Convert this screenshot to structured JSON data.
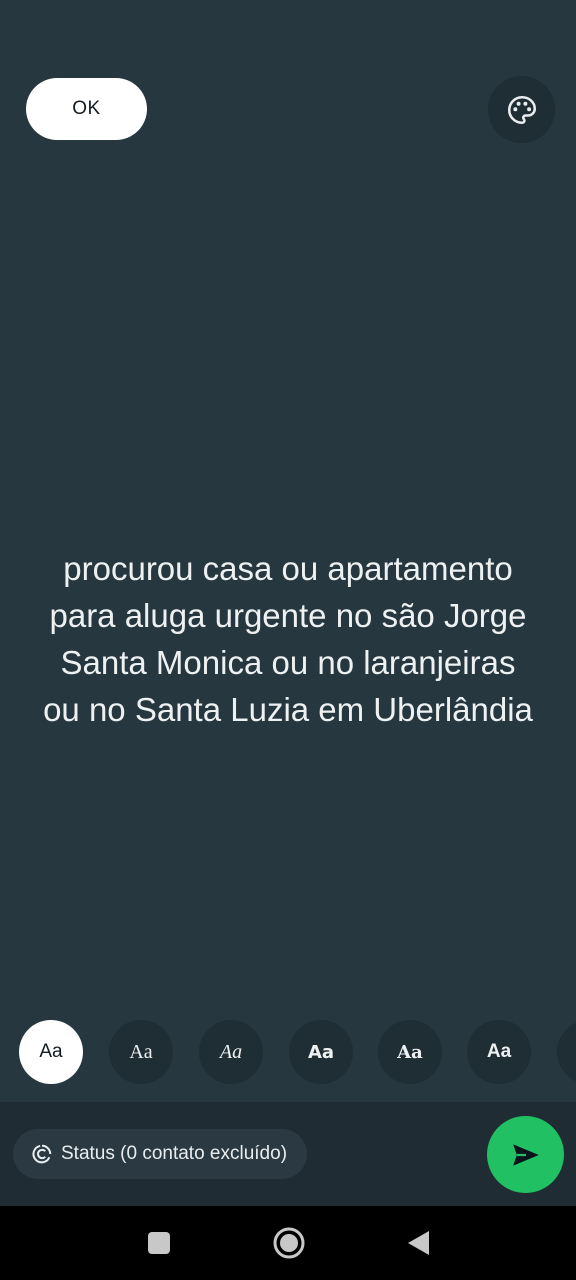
{
  "header": {
    "ok_label": "OK",
    "palette_icon": "palette-icon"
  },
  "status": {
    "lines": [
      "procurou casa ou apartamento",
      "para aluga urgente no são Jorge",
      "Santa Monica ou no laranjeiras",
      "ou no Santa Luzia em Uberlândia"
    ]
  },
  "font_picker": {
    "options": [
      {
        "label": "Aa",
        "selected": true
      },
      {
        "label": "Aa",
        "selected": false
      },
      {
        "label": "Aa",
        "selected": false
      },
      {
        "label": "Aa",
        "selected": false
      },
      {
        "label": "Aa",
        "selected": false
      },
      {
        "label": "Aa",
        "selected": false
      }
    ]
  },
  "audience": {
    "label": "Status (0 contato excluído)",
    "icon": "status-ring-icon"
  },
  "send": {
    "icon": "send-icon"
  },
  "system_nav": {
    "recents_icon": "square-icon",
    "home_icon": "circle-icon",
    "back_icon": "triangle-back-icon"
  },
  "colors": {
    "background": "#263740",
    "send_green": "#21c063",
    "chip": "#1f2d34"
  }
}
